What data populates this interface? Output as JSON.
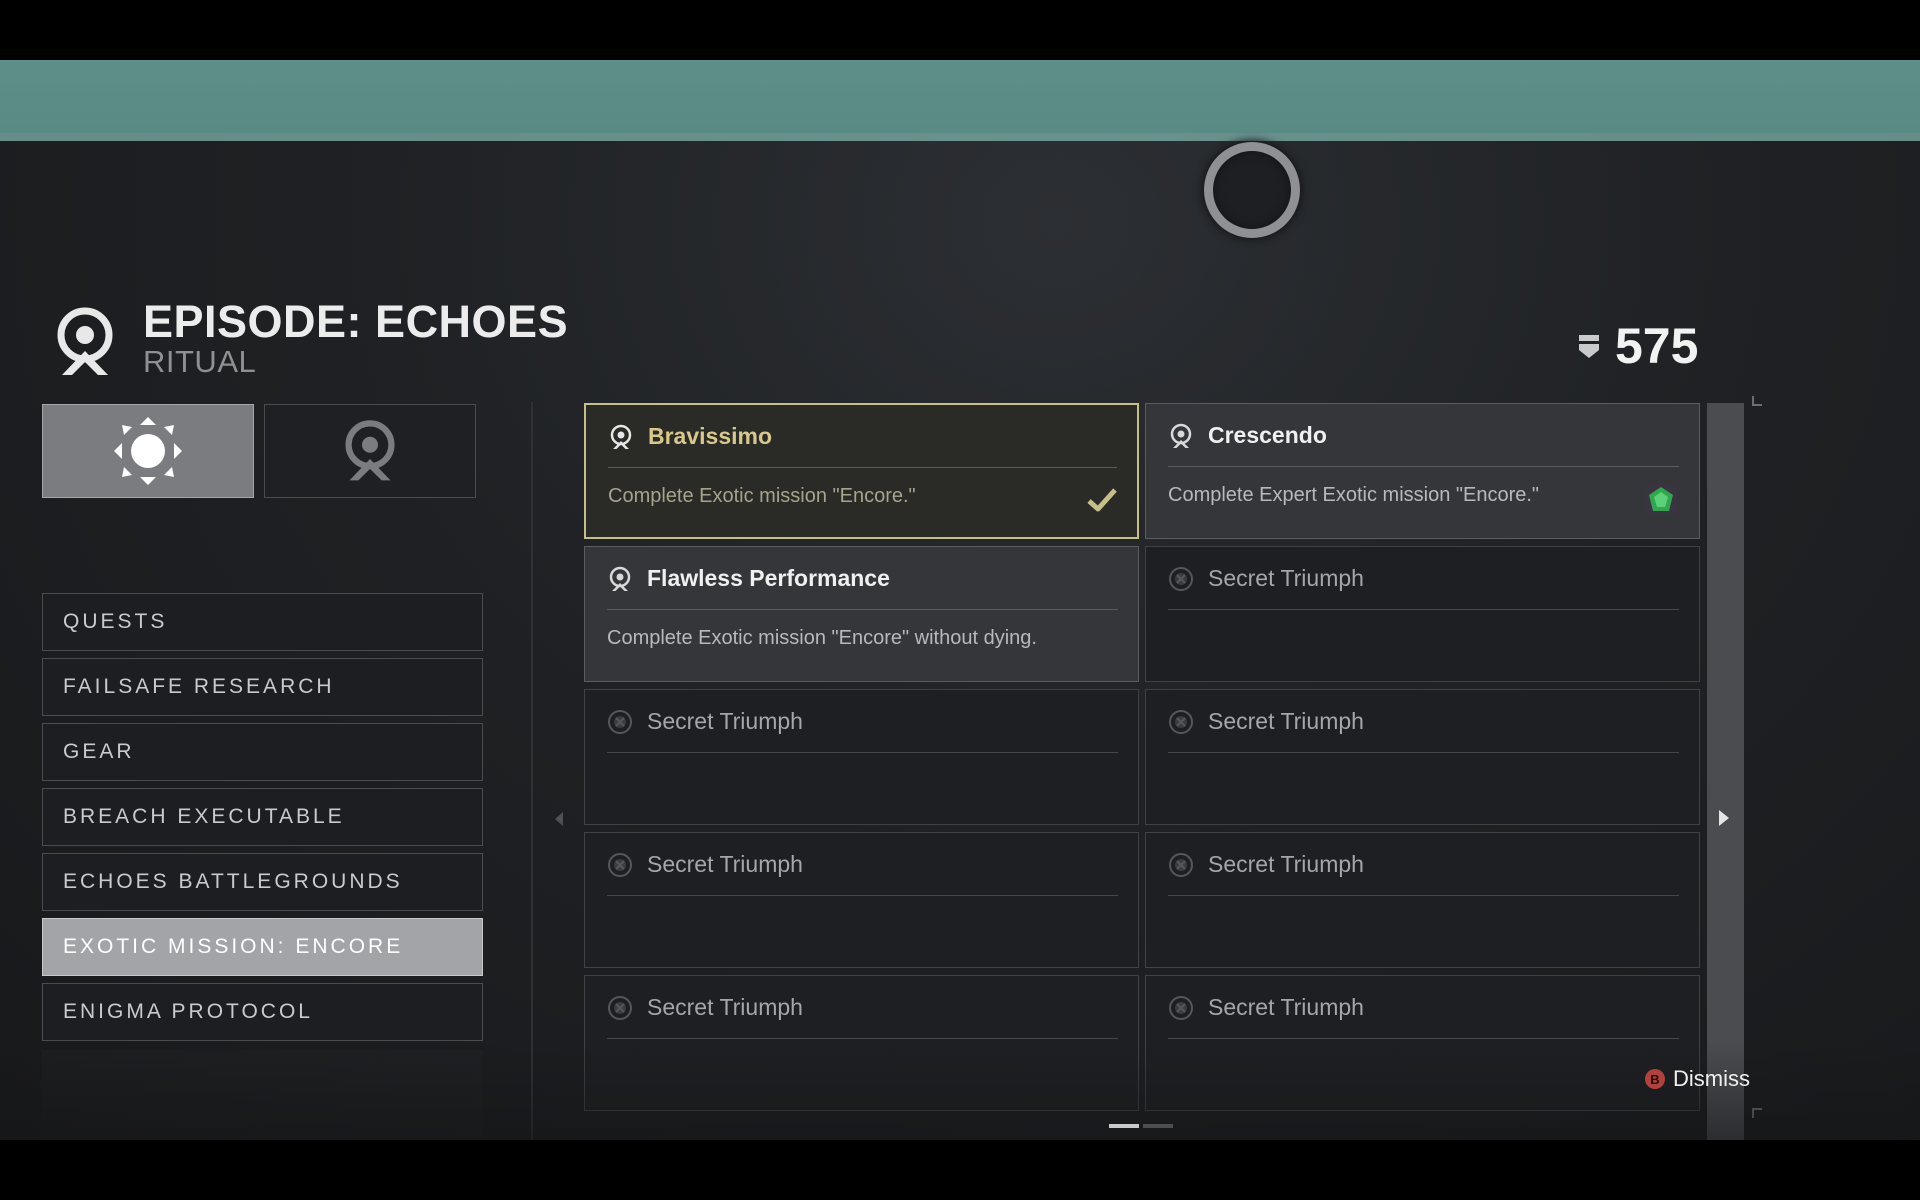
{
  "header": {
    "title": "EPISODE: ECHOES",
    "subtitle": "RITUAL",
    "score": "575",
    "score_icon": "seal-icon",
    "logo_icon": "ritual-emblem-icon"
  },
  "mode_tabs": [
    {
      "icon": "sun-emblem-icon",
      "selected": true
    },
    {
      "icon": "ritual-emblem-icon",
      "selected": false
    }
  ],
  "nav": {
    "items": [
      {
        "label": "QUESTS"
      },
      {
        "label": "FAILSAFE RESEARCH"
      },
      {
        "label": "GEAR"
      },
      {
        "label": "BREACH EXECUTABLE"
      },
      {
        "label": "ECHOES BATTLEGROUNDS"
      },
      {
        "label": "EXOTIC MISSION: ENCORE",
        "selected": true
      },
      {
        "label": "ENIGMA PROTOCOL"
      }
    ]
  },
  "triumphs": [
    {
      "title": "Bravissimo",
      "description": "Complete Exotic mission \"Encore.\"",
      "state": "completed",
      "badge": "checkmark-icon"
    },
    {
      "title": "Crescendo",
      "description": "Complete Expert Exotic mission \"Encore.\"",
      "state": "revealed",
      "badge": "reward-gem-icon"
    },
    {
      "title": "Flawless Performance",
      "description": "Complete Exotic mission \"Encore\" without dying.",
      "state": "revealed"
    },
    {
      "title": "Secret Triumph",
      "state": "secret"
    },
    {
      "title": "Secret Triumph",
      "state": "secret"
    },
    {
      "title": "Secret Triumph",
      "state": "secret"
    },
    {
      "title": "Secret Triumph",
      "state": "secret"
    },
    {
      "title": "Secret Triumph",
      "state": "secret"
    },
    {
      "title": "Secret Triumph",
      "state": "secret"
    },
    {
      "title": "Secret Triumph",
      "state": "secret"
    }
  ],
  "footer": {
    "dismiss_button": "B",
    "dismiss_label": "Dismiss",
    "pages": 2,
    "current_page": 1
  },
  "colors": {
    "banner": "#5f8f89",
    "completed_border": "#c7bf8a",
    "completed_title": "#d8c98a",
    "selected_nav": "#a3a4a7",
    "dismiss_button": "#b0413b",
    "gem": "#2fa84f"
  }
}
